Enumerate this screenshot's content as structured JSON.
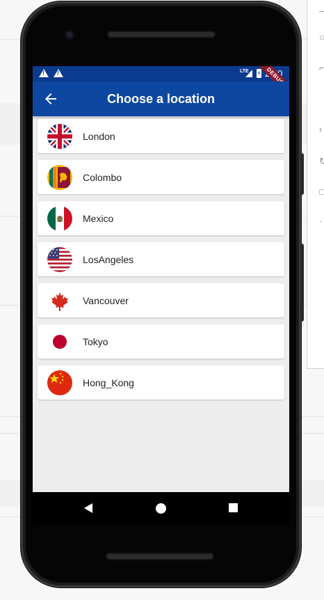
{
  "status_bar": {
    "time": "2:40",
    "network": "LTE",
    "debug_banner": "DEBUG"
  },
  "app_bar": {
    "title": "Choose a location",
    "back_icon": "arrow-back-icon"
  },
  "locations": [
    {
      "label": "London",
      "flag": "uk-flag-icon"
    },
    {
      "label": "Colombo",
      "flag": "sri-lanka-flag-icon"
    },
    {
      "label": "Mexico",
      "flag": "mexico-flag-icon"
    },
    {
      "label": "LosAngeles",
      "flag": "usa-flag-icon"
    },
    {
      "label": "Vancouver",
      "flag": "canada-flag-icon"
    },
    {
      "label": "Tokyo",
      "flag": "japan-flag-icon"
    },
    {
      "label": "Hong_Kong",
      "flag": "china-flag-icon"
    }
  ],
  "colors": {
    "app_bar": "#0d47a1",
    "status_bar": "#0a3b8f",
    "background": "#ededed"
  },
  "nav": {
    "back": "nav-back-icon",
    "home": "nav-home-icon",
    "recents": "nav-recents-icon"
  }
}
